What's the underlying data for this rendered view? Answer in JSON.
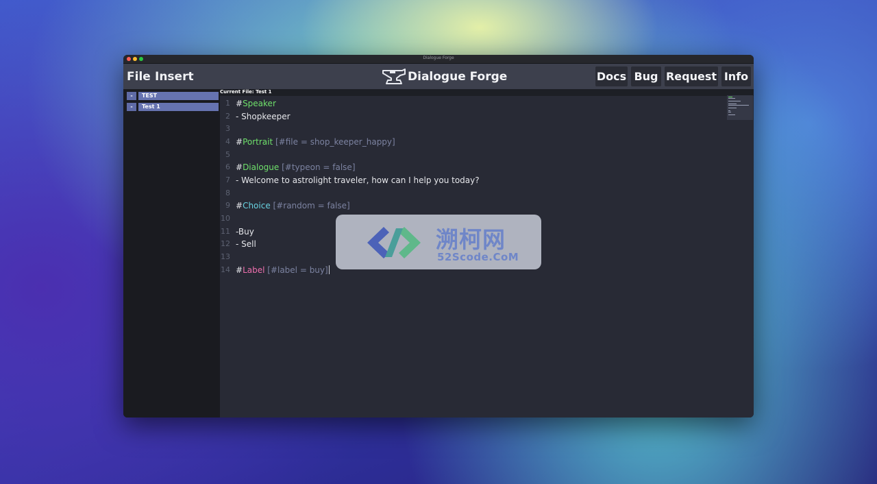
{
  "window": {
    "title": "Dialogue Forge"
  },
  "menubar": {
    "file": "File",
    "insert": "Insert",
    "app_title": "Dialogue Forge",
    "app_icon": "anvil-icon",
    "buttons": {
      "docs": "Docs",
      "bug": "Bug",
      "request": "Request",
      "info": "Info"
    }
  },
  "sidebar": {
    "items": [
      {
        "toggle": "-",
        "label": "TEST"
      },
      {
        "toggle": "-",
        "label": "Test 1"
      }
    ]
  },
  "editor": {
    "current_file": "Current File: Test 1",
    "lines": [
      {
        "num": "1",
        "hash": "#",
        "keyword": "Speaker",
        "params": ""
      },
      {
        "num": "2",
        "text": "- Shopkeeper"
      },
      {
        "num": "3",
        "text": ""
      },
      {
        "num": "4",
        "hash": "#",
        "keyword": "Portrait",
        "params": " [#file = shop_keeper_happy]"
      },
      {
        "num": "5",
        "text": ""
      },
      {
        "num": "6",
        "hash": "#",
        "keyword": "Dialogue",
        "params": " [#typeon = false]"
      },
      {
        "num": "7",
        "text": "- Welcome to astrolight traveler, how can I help you today?"
      },
      {
        "num": "8",
        "text": ""
      },
      {
        "num": "9",
        "hash": "#",
        "keyword": "Choice",
        "params": " [#random = false]"
      },
      {
        "num": "10",
        "text": ""
      },
      {
        "num": "11",
        "text": "-Buy"
      },
      {
        "num": "12",
        "text": "- Sell"
      },
      {
        "num": "13",
        "text": ""
      },
      {
        "num": "14",
        "hash": "#",
        "keyword": "Label",
        "params": " [#label = buy]"
      }
    ]
  },
  "watermark": {
    "chinese": "溯柯网",
    "english": "52Scode.CoM"
  },
  "colors": {
    "speaker": "#6fe06b",
    "portrait": "#6fe06b",
    "dialogue": "#6fe06b",
    "choice": "#69d3e2",
    "label": "#ee6fae",
    "params": "#7c83a1"
  }
}
